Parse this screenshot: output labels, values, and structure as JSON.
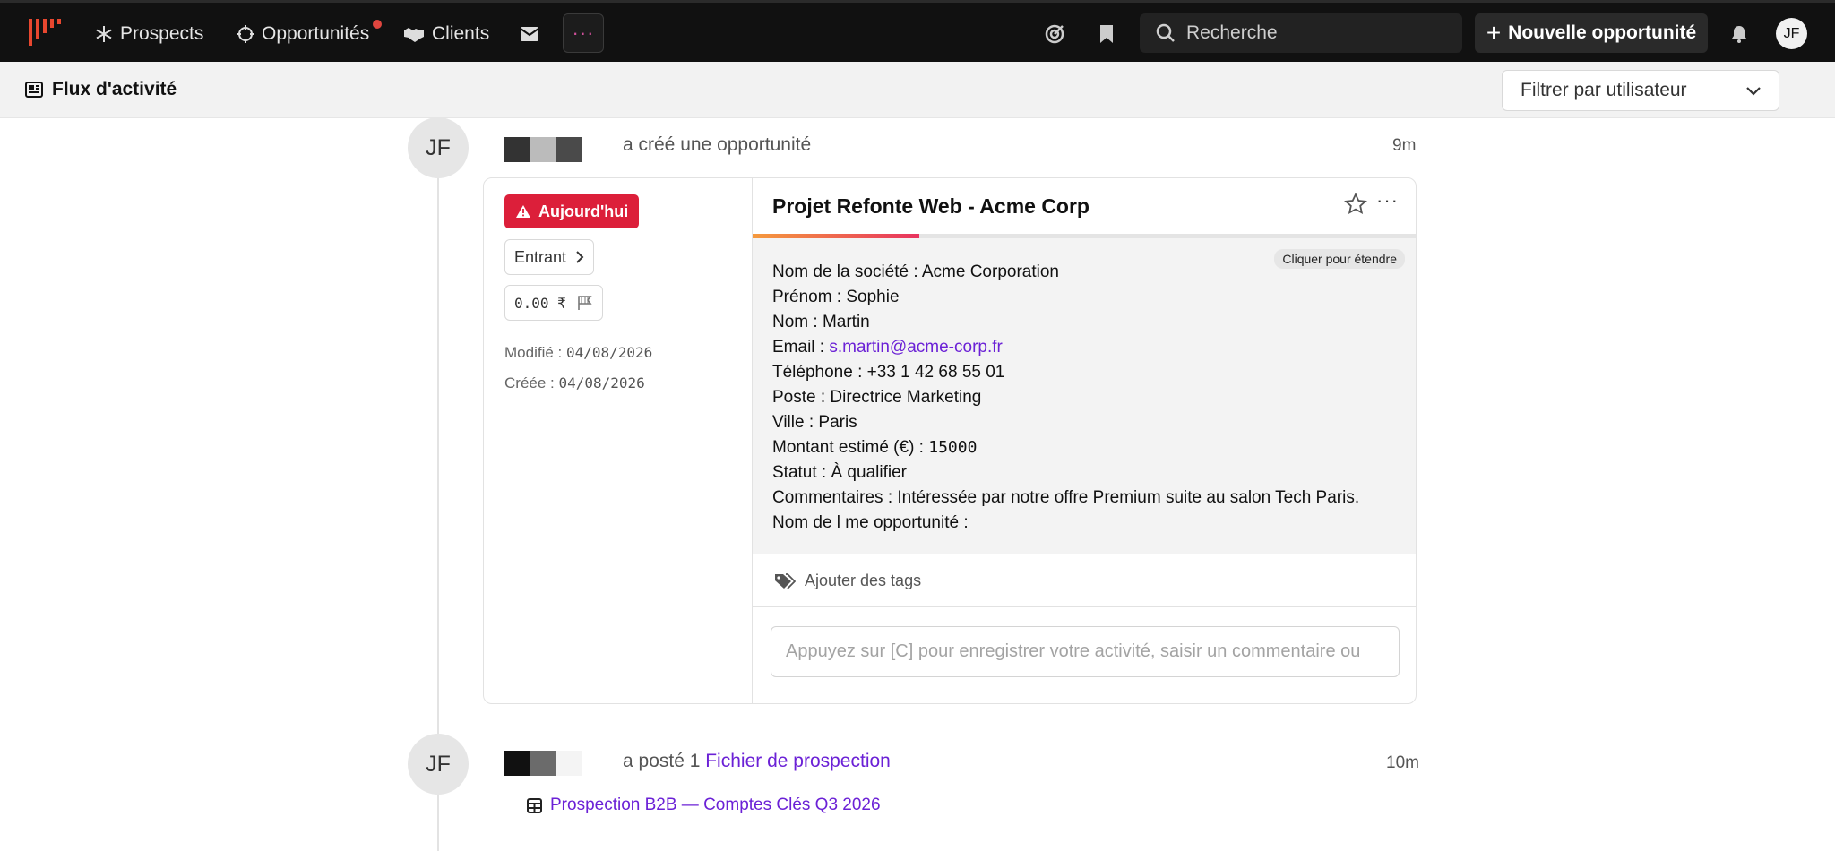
{
  "nav": {
    "items": [
      {
        "label": "Prospects",
        "icon": "snowflake-icon"
      },
      {
        "label": "Opportunités",
        "icon": "crosshair-icon"
      },
      {
        "label": "Clients",
        "icon": "handshake-icon"
      }
    ],
    "search_placeholder": "Recherche",
    "new_button_label": "Nouvelle opportunité",
    "user_initials": "JF",
    "accent_color": "#d0509a",
    "notification_dot_color": "#e0463f"
  },
  "subheader": {
    "title": "Flux d'activité",
    "filter_label": "Filtrer par utilisateur"
  },
  "feed": [
    {
      "initials": "JF",
      "action": "a créé une opportunité",
      "time": "9m",
      "card": {
        "due_badge": "Aujourd'hui",
        "source": "Entrant",
        "amount": "0.00 ₹",
        "modified_label": "Modifié :",
        "modified_date": "04/08/2026",
        "created_label": "Créée :",
        "created_date": "04/08/2026",
        "title": "Projet Refonte Web - Acme Corp",
        "progress_fraction": 0.25,
        "expand_label": "Cliquer pour étendre",
        "details": {
          "company": "Nom de la société : Acme Corporation",
          "first_name": "Prénom : Sophie",
          "last_name": "Nom : Martin",
          "email_label": "Email : ",
          "email": "s.martin@acme-corp.fr",
          "phone_label": "Téléphone : ",
          "phone": "+33 1 42 68 55 01",
          "position": "Poste : Directrice Marketing",
          "city": "Ville : Paris",
          "amount_label": "Montant estimé (€) : ",
          "amount": "15000",
          "status": "Statut : À qualifier",
          "comments": "Commentaires : Intéressée par notre offre Premium suite au salon Tech Paris.",
          "opportunity_name": "Nom de l me opportunité :"
        },
        "tags_label": "Ajouter des tags",
        "comment_placeholder": "Appuyez sur [C] pour enregistrer votre activité, saisir un commentaire ou"
      }
    },
    {
      "initials": "JF",
      "action_prefix": "a posté 1 ",
      "action_link": "Fichier de prospection",
      "time": "10m",
      "file_name": "Prospection B2B — Comptes Clés Q3 2026"
    }
  ]
}
